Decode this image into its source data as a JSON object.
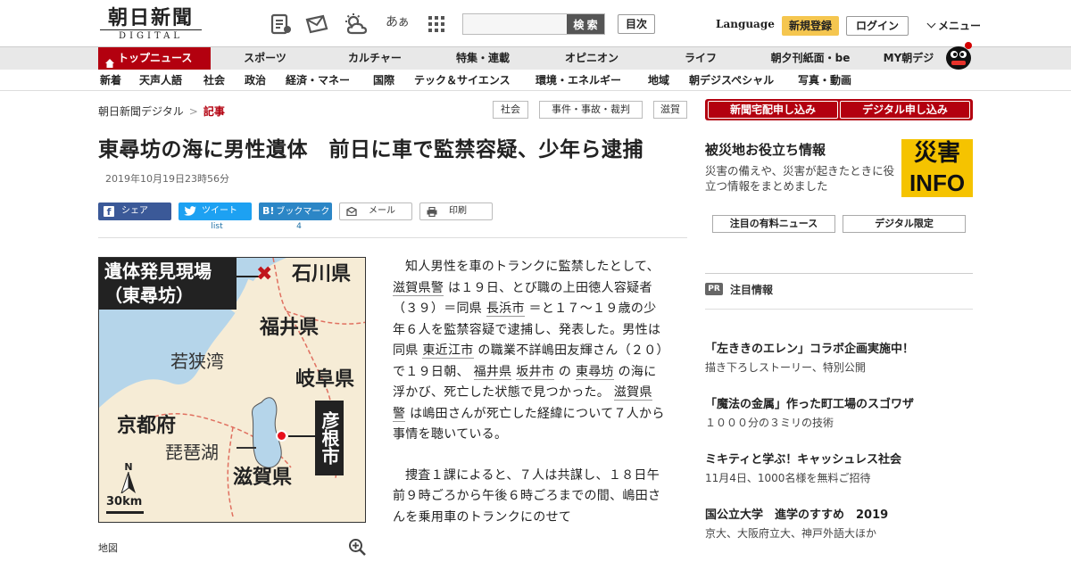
{
  "header": {
    "logo_jp": "朝日新聞",
    "logo_en": "DIGITAL",
    "search_placeholder": "",
    "search_label": "検 索",
    "toc_label": "目次",
    "language_label": "Language",
    "register_label": "新規登録",
    "login_label": "ログイン",
    "menu_label": "メニュー",
    "font_size_icon_glyph": "あぁ"
  },
  "nav_primary": {
    "top": "トップニュース",
    "items": [
      "スポーツ",
      "カルチャー",
      "特集・連載",
      "オピニオン",
      "ライフ",
      "朝夕刊紙面・be",
      "MY朝デジ"
    ]
  },
  "nav_secondary": {
    "items": [
      "新着",
      "天声人語",
      "社会",
      "政治",
      "経済・マネー",
      "国際",
      "テック＆サイエンス",
      "環境・エネルギー",
      "地域",
      "朝デジスペシャル",
      "写真・動画"
    ]
  },
  "breadcrumb": {
    "home": "朝日新聞デジタル",
    "separator": ">",
    "current": "記事"
  },
  "tags": [
    "社会",
    "事件・事故・裁判",
    "滋賀"
  ],
  "article": {
    "title": "東尋坊の海に男性遺体　前日に車で監禁容疑、少年ら逮捕",
    "date": "2019年10月19日23時56分",
    "share": {
      "facebook": "シェア",
      "twitter": "ツイート",
      "twitter_sub": "list",
      "hatena": "ブックマーク",
      "hatena_icon": "B!",
      "hatena_count": "4",
      "mail": "メール",
      "print": "印刷"
    },
    "map": {
      "label_scene": "遺体発見現場",
      "label_scene_sub": "（東尋坊）",
      "ishikawa": "石川県",
      "fukui": "福井県",
      "wakasa": "若狭湾",
      "gifu": "岐阜県",
      "kyoto": "京都府",
      "biwako": "琵琶湖",
      "shiga": "滋賀県",
      "hikone": "彦根市",
      "north": "N",
      "scale": "30km",
      "caption": "地図"
    },
    "body": [
      [
        {
          "t": "知人男性を車のトランクに監禁したとして、 "
        },
        {
          "t": "滋賀県警",
          "link": true
        },
        {
          "t": " は１９日、とび職の上田徳人容疑者（３９）＝同県 "
        },
        {
          "t": "長浜市",
          "link": true
        },
        {
          "t": " ＝と１７～１９歳の少年６人を監禁容疑で逮捕し、発表した。男性は同県 "
        },
        {
          "t": "東近江市",
          "link": true
        },
        {
          "t": " の職業不詳嶋田友輝さん（２０）で１９日朝、 "
        },
        {
          "t": "福井県",
          "link": true
        },
        {
          "t": " "
        },
        {
          "t": "坂井市",
          "link": true
        },
        {
          "t": " の "
        },
        {
          "t": "東尋坊",
          "link": true
        },
        {
          "t": " の海に浮かび、死亡した状態で見つかった。 "
        },
        {
          "t": "滋賀県警",
          "link": true
        },
        {
          "t": " は嶋田さんが死亡した経緯について７人から事情を聴いている。"
        }
      ],
      [
        {
          "t": "捜査１課によると、７人は共謀し、１８日午前９時ごろから午後６時ごろまでの間、嶋田さんを乗用車のトランクにのせて"
        }
      ]
    ]
  },
  "sidebar": {
    "subscribe_home": "新聞宅配申し込み",
    "subscribe_digital": "デジタル申し込み",
    "saigai_title": "被災地お役立ち情報",
    "saigai_desc": "災害の備えや、災害が起きたときに役立つ情報をまとめました",
    "saigai_img_line1": "災害",
    "saigai_img_line2": "INFO",
    "btn_paid_news": "注目の有料ニュース",
    "btn_digital_only": "デジタル限定",
    "pr_badge": "PR",
    "pr_heading": "注目情報",
    "pr_items": [
      {
        "title": "「左ききのエレン」コラボ企画実施中！",
        "desc": "描き下ろしストーリー、特別公開"
      },
      {
        "title": "「魔法の金属」作った町工場のスゴワザ",
        "desc": "１０００分の３ミリの技術"
      },
      {
        "title": "ミキティと学ぶ！キャッシュレス社会",
        "desc": "11月4日、1000名様を無料ご招待"
      },
      {
        "title": "国公立大学　進学のすすめ　2019",
        "desc": "京大、大阪府立大、神戸外語大ほか"
      }
    ]
  },
  "colors": {
    "accent_red": "#b3000f",
    "register_yellow": "#f5c64f",
    "facebook": "#3b5998",
    "twitter": "#1da1f2",
    "hatena": "#2c86c6"
  }
}
